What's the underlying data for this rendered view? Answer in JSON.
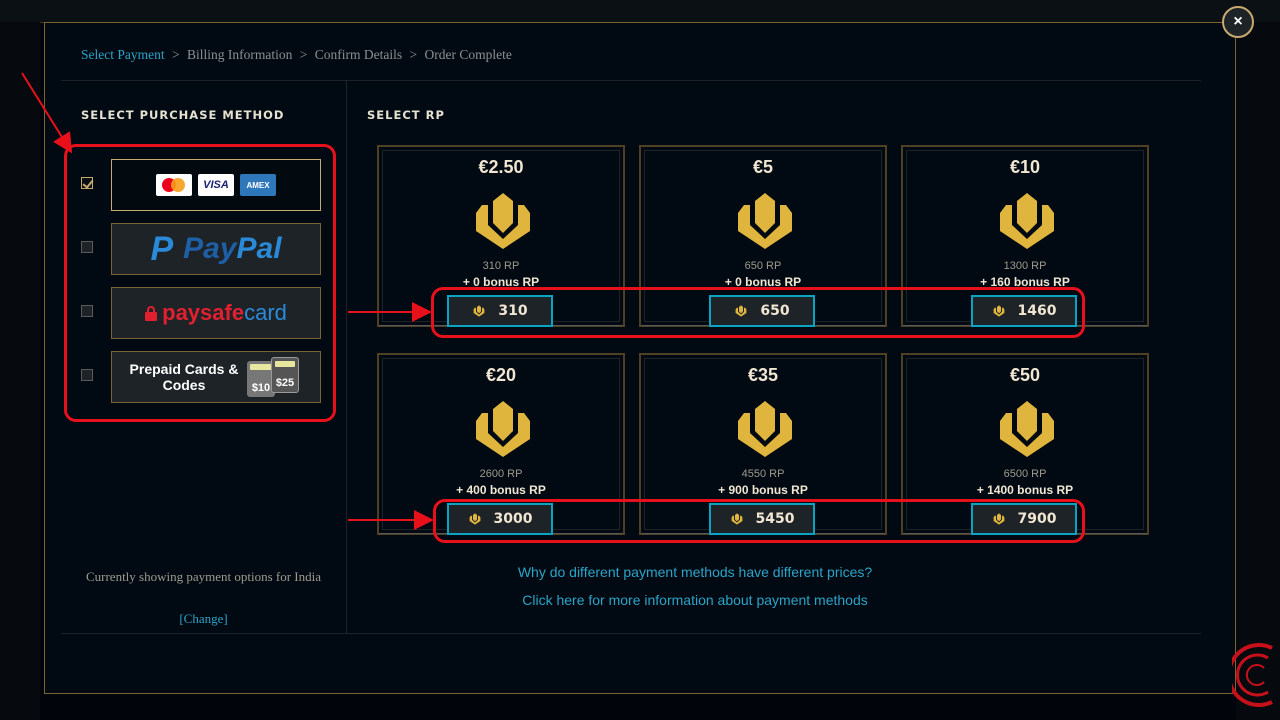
{
  "breadcrumb": {
    "steps": [
      "Select Payment",
      "Billing Information",
      "Confirm Details",
      "Order Complete"
    ],
    "separator": ">"
  },
  "left_panel": {
    "title": "SELECT PURCHASE METHOD",
    "methods": [
      {
        "name": "credit-card",
        "checked": true,
        "logos": [
          "VISA",
          "AMEX"
        ]
      },
      {
        "name": "paypal",
        "checked": false,
        "label_a": "Pay",
        "label_b": "Pal",
        "icon_letter": "P"
      },
      {
        "name": "paysafecard",
        "checked": false,
        "label_a": "paysafe",
        "label_b": "card"
      },
      {
        "name": "prepaid",
        "checked": false,
        "label": "Prepaid Cards & Codes",
        "card_a": "$10",
        "card_b": "$25"
      }
    ],
    "country_text": "Currently showing payment options for  India",
    "change_label": "[Change]"
  },
  "right_panel": {
    "title": "SELECT RP",
    "packs": [
      {
        "price": "€2.50",
        "rp": "310 RP",
        "bonus": "+ 0 bonus RP",
        "total": "310"
      },
      {
        "price": "€5",
        "rp": "650 RP",
        "bonus": "+ 0 bonus RP",
        "total": "650"
      },
      {
        "price": "€10",
        "rp": "1300 RP",
        "bonus": "+ 160 bonus RP",
        "total": "1460"
      },
      {
        "price": "€20",
        "rp": "2600 RP",
        "bonus": "+ 400 bonus RP",
        "total": "3000"
      },
      {
        "price": "€35",
        "rp": "4550 RP",
        "bonus": "+ 900 bonus RP",
        "total": "5450"
      },
      {
        "price": "€50",
        "rp": "6500 RP",
        "bonus": "+ 1400 bonus RP",
        "total": "7900"
      }
    ],
    "link_prices": "Why do different payment methods have different prices?",
    "link_info": "Click here for more information about payment methods"
  },
  "close_label": "×",
  "colors": {
    "accent_gold": "#c8aa6e",
    "link_blue": "#2ba4c7",
    "annotation_red": "#e8101a",
    "button_border": "#0aa3c2"
  }
}
